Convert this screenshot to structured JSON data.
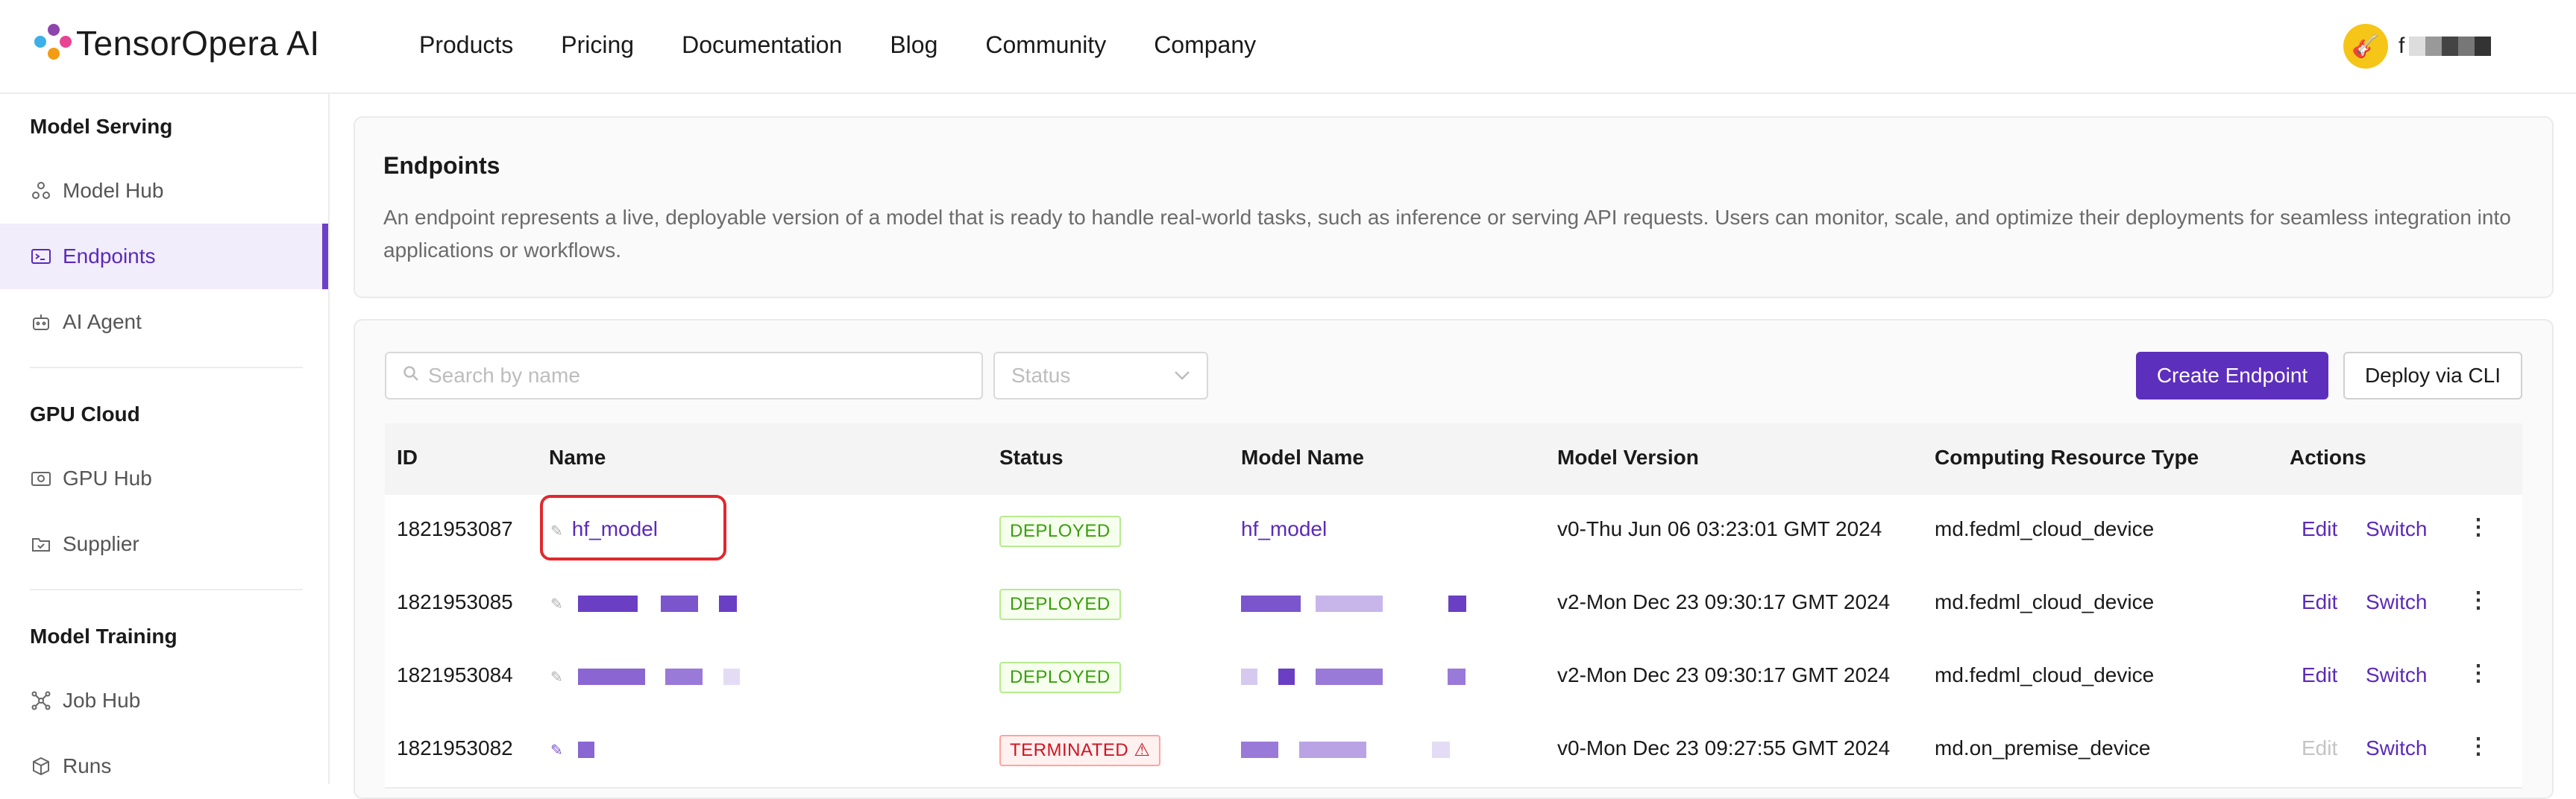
{
  "brand": {
    "name": "TensorOpera AI"
  },
  "nav": {
    "items": [
      "Products",
      "Pricing",
      "Documentation",
      "Blog",
      "Community",
      "Company"
    ]
  },
  "user": {
    "initial": "f"
  },
  "sidebar": {
    "sections": [
      {
        "title": "Model Serving",
        "items": [
          {
            "label": "Model Hub",
            "icon": "cube-network-icon"
          },
          {
            "label": "Endpoints",
            "icon": "terminal-icon",
            "active": true
          },
          {
            "label": "AI Agent",
            "icon": "robot-icon"
          }
        ]
      },
      {
        "title": "GPU Cloud",
        "items": [
          {
            "label": "GPU Hub",
            "icon": "image-icon"
          },
          {
            "label": "Supplier",
            "icon": "folder-icon"
          }
        ]
      },
      {
        "title": "Model Training",
        "items": [
          {
            "label": "Job Hub",
            "icon": "network-icon"
          },
          {
            "label": "Runs",
            "icon": "box-icon"
          }
        ]
      }
    ]
  },
  "endpoints": {
    "title": "Endpoints",
    "description": "An endpoint represents a live, deployable version of a model that is ready to handle real-world tasks, such as inference or serving API requests. Users can monitor, scale, and optimize their deployments for seamless integration into applications or workflows."
  },
  "toolbar": {
    "search_placeholder": "Search by name",
    "status_placeholder": "Status",
    "create_label": "Create Endpoint",
    "deploy_label": "Deploy via CLI"
  },
  "table": {
    "columns": [
      "ID",
      "Name",
      "Status",
      "Model Name",
      "Model Version",
      "Computing Resource Type",
      "Actions"
    ],
    "rows": [
      {
        "id": "1821953087",
        "name": "hf_model",
        "status": "DEPLOYED",
        "model_name": "hf_model",
        "version": "v0-Thu Jun 06 03:23:01 GMT 2024",
        "resource": "md.fedml_cloud_device",
        "edit": "Edit",
        "switch": "Switch",
        "edit_disabled": false
      },
      {
        "id": "1821953085",
        "name": "",
        "status": "DEPLOYED",
        "model_name": "",
        "version": "v2-Mon Dec 23 09:30:17 GMT 2024",
        "resource": "md.fedml_cloud_device",
        "edit": "Edit",
        "switch": "Switch",
        "edit_disabled": false
      },
      {
        "id": "1821953084",
        "name": "",
        "status": "DEPLOYED",
        "model_name": "",
        "version": "v2-Mon Dec 23 09:30:17 GMT 2024",
        "resource": "md.fedml_cloud_device",
        "edit": "Edit",
        "switch": "Switch",
        "edit_disabled": false
      },
      {
        "id": "1821953082",
        "name": "",
        "status": "TERMINATED",
        "model_name": "",
        "version": "v0-Mon Dec 23 09:27:55 GMT 2024",
        "resource": "md.on_premise_device",
        "edit": "Edit",
        "switch": "Switch",
        "edit_disabled": true
      }
    ]
  },
  "colors": {
    "accent": "#5d2fbd",
    "deployed": "#389e0d",
    "terminated": "#cf1322",
    "highlight": "#e0282e"
  }
}
